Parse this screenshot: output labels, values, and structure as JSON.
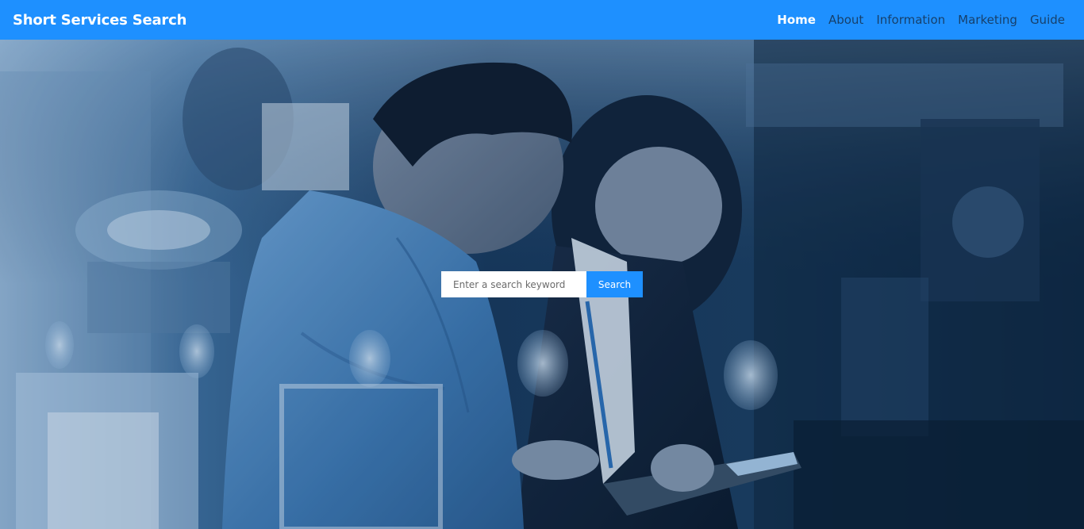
{
  "navbar": {
    "brand": "Short Services Search",
    "links": [
      {
        "label": "Home",
        "active": true
      },
      {
        "label": "About",
        "active": false
      },
      {
        "label": "Information",
        "active": false
      },
      {
        "label": "Marketing",
        "active": false
      },
      {
        "label": "Guide",
        "active": false
      }
    ]
  },
  "search": {
    "placeholder": "Enter a search keyword",
    "value": "",
    "button_label": "Search"
  },
  "colors": {
    "navbar_bg": "#1e90ff",
    "nav_link": "#17406b",
    "nav_link_active": "#ffffff",
    "search_button_bg": "#1e90ff"
  }
}
